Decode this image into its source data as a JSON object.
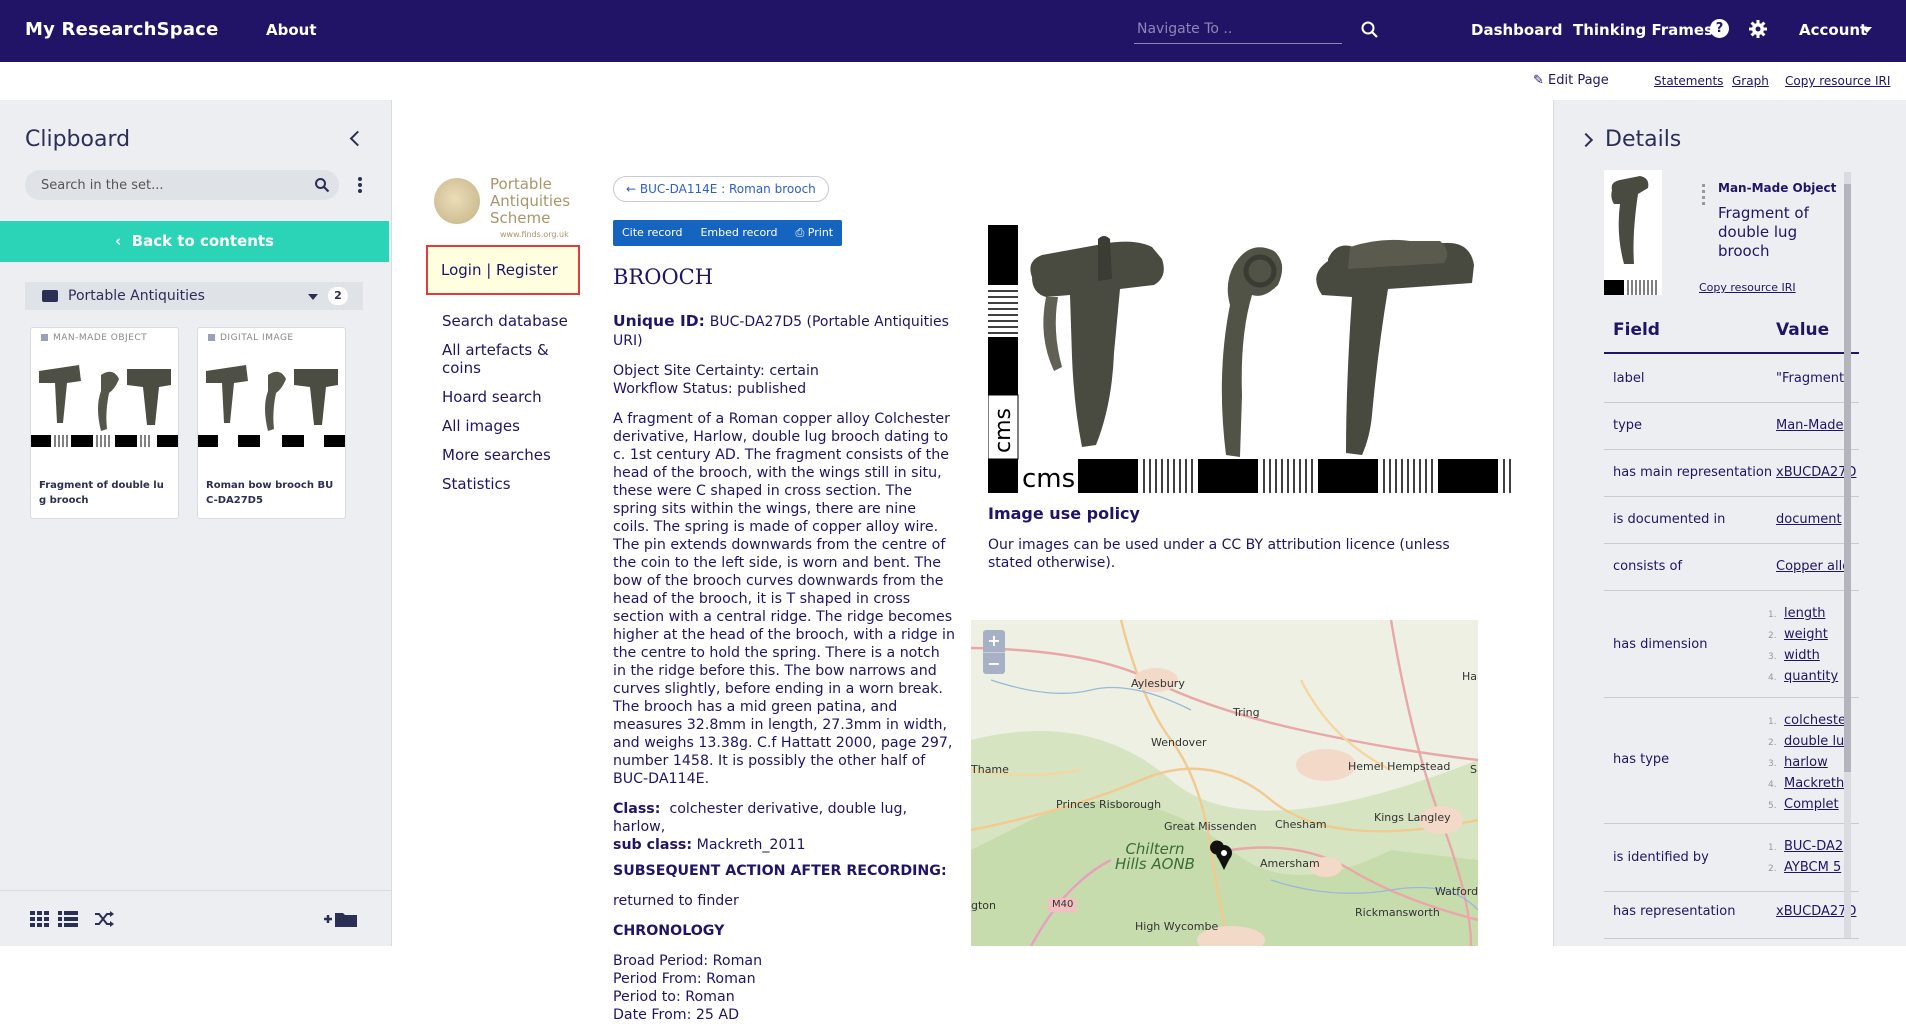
{
  "topnav": {
    "brand": "My ResearchSpace",
    "about": "About",
    "search_placeholder": "Navigate To ..",
    "dashboard": "Dashboard",
    "thinking_frames": "Thinking Frames",
    "help": "?",
    "account": "Account"
  },
  "subbar": {
    "edit_page": "Edit Page",
    "statements": "Statements",
    "graph": "Graph",
    "copy_iri": "Copy resource IRI"
  },
  "clipboard": {
    "title": "Clipboard",
    "search_placeholder": "Search in the set...",
    "back": "Back to contents",
    "set_name": "Portable Antiquities",
    "set_count": "2",
    "items": [
      {
        "kind": "MAN-MADE OBJECT",
        "label": "Fragment of double lug brooch"
      },
      {
        "kind": "DIGITAL IMAGE",
        "label": "Roman bow brooch BUC-DA27D5"
      }
    ]
  },
  "pas": {
    "logo_text": "Portable Antiquities Scheme",
    "logo_url": "www.finds.org.uk",
    "login": "Login | Register",
    "nav": [
      "Search database",
      "All artefacts & coins",
      "Hoard search",
      "All images",
      "More searches",
      "Statistics"
    ]
  },
  "record": {
    "back_pill": "← BUC-DA114E : Roman brooch",
    "buttons": {
      "cite": "Cite record",
      "embed": "Embed record",
      "print": "Print"
    },
    "title": "BROOCH",
    "uid_label": "Unique ID:",
    "uid_value": "BUC-DA27D5 (Portable Antiquities URI)",
    "certainty": "Object Site Certainty: certain",
    "workflow": "Workflow Status: published",
    "description": "A fragment of a Roman copper alloy Colchester derivative, Harlow, double lug brooch dating to c. 1st century AD. The fragment consists of the head of the brooch, with the wings still in situ, these were C shaped in cross section. The spring sits within the wings, there are nine coils. The spring is made of copper alloy wire. The pin extends downwards from the centre of the coin to the left side, is worn and bent. The bow of the brooch curves downwards from the head of the brooch, it is T shaped in cross section with a central ridge. The ridge becomes higher at the head of the brooch, with a ridge in the centre to hold the spring. There is a notch in the ridge before this. The bow narrows and curves slightly, before ending in a worn break. The brooch has a mid green patina, and measures 32.8mm in length, 27.3mm in width, and weighs 13.38g. C.f Hattatt 2000, page 297, number 1458. It is possibly the other half of BUC-DA114E.",
    "class_label": "Class:",
    "class_value": "colchester derivative,  double lug,  harlow,",
    "subclass_label": "sub class:",
    "subclass_value": "Mackreth_2011",
    "subsequent_h": "SUBSEQUENT ACTION AFTER RECORDING:",
    "subsequent_v": "returned to finder",
    "chronology_h": "CHRONOLOGY",
    "broad_period": "Broad Period: Roman",
    "period_from": "Period From: Roman",
    "period_to": "Period to: Roman",
    "date_from": "Date From: 25 AD"
  },
  "image": {
    "scale_label": "cms",
    "policy_heading": "Image use policy",
    "policy_text": "Our images can be used under a CC BY attribution licence (unless stated otherwise)."
  },
  "map": {
    "zoom_in": "+",
    "zoom_out": "−",
    "labels": [
      "Aylesbury",
      "Tring",
      "Wendover",
      "Thame",
      "Hemel Hempstead",
      "Princes Risborough",
      "Great Missenden",
      "Chesham",
      "Kings Langley",
      "Amersham",
      "High Wycombe",
      "Rickmansworth",
      "Watford",
      "M40",
      "gton",
      "Ha",
      "S"
    ],
    "aonb": "Chiltern Hills AONB"
  },
  "details": {
    "title": "Details",
    "type": "Man-Made Object",
    "label": "Fragment of double lug brooch",
    "copy_iri": "Copy resource IRI",
    "field_h": "Field",
    "value_h": "Value",
    "rows": [
      {
        "field": "label",
        "value": "\"Fragment"
      },
      {
        "field": "type",
        "value": "Man-Made"
      },
      {
        "field": "has main representation",
        "value": "xBUCDA27D"
      },
      {
        "field": "is documented in",
        "value": "document"
      },
      {
        "field": "consists of",
        "value": "Copper allo"
      },
      {
        "field": "has dimension",
        "list": [
          "length",
          "weight",
          "width",
          "quantity"
        ]
      },
      {
        "field": "has type",
        "list": [
          "colcheste",
          "double lu",
          "harlow",
          "Mackreth",
          "Complet"
        ]
      },
      {
        "field": "is identified by",
        "list": [
          "BUC-DA2",
          "AYBCM 5"
        ]
      },
      {
        "field": "has representation",
        "value": "xBUCDA27D"
      }
    ]
  }
}
